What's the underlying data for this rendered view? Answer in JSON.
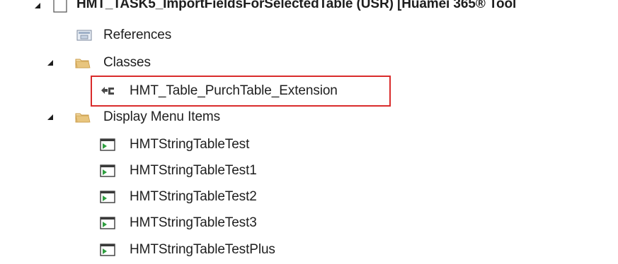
{
  "project": {
    "label": "HMT_TASK5_ImportFieldsForSelectedTable (USR) [Huamei 365® Tool"
  },
  "nodes": {
    "references": {
      "label": "References",
      "icon": "references-icon"
    },
    "classes": {
      "label": "Classes",
      "icon": "folder-icon",
      "items": [
        {
          "label": "HMT_Table_PurchTable_Extension",
          "icon": "class-extension-icon",
          "highlighted": true
        }
      ]
    },
    "display_menu_items": {
      "label": "Display Menu Items",
      "icon": "folder-icon",
      "items": [
        {
          "label": "HMTStringTableTest",
          "icon": "display-menu-item-icon"
        },
        {
          "label": "HMTStringTableTest1",
          "icon": "display-menu-item-icon"
        },
        {
          "label": "HMTStringTableTest2",
          "icon": "display-menu-item-icon"
        },
        {
          "label": "HMTStringTableTest3",
          "icon": "display-menu-item-icon"
        },
        {
          "label": "HMTStringTableTestPlus",
          "icon": "display-menu-item-icon"
        }
      ]
    }
  },
  "colors": {
    "highlight_border": "#d92b2b",
    "folder": "#d8b06a",
    "menu_item_green": "#2e9e3f"
  }
}
